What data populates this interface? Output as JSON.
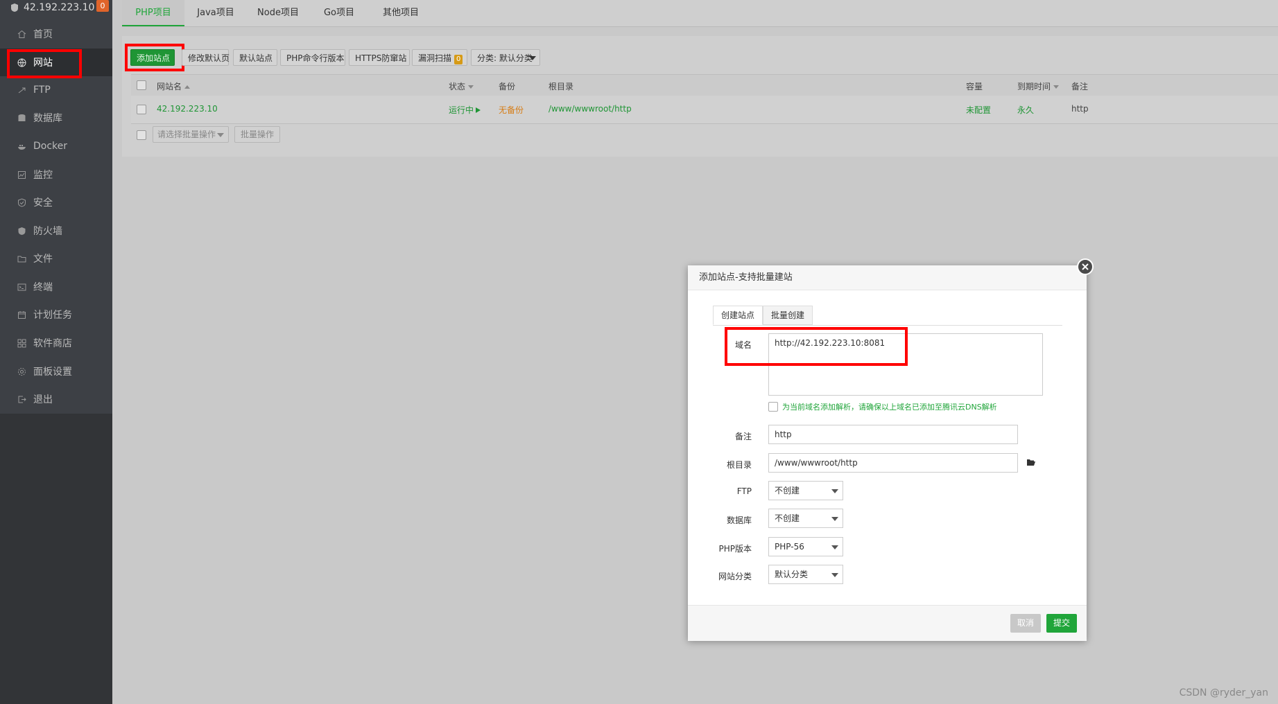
{
  "sidebar": {
    "server_ip": "42.192.223.10",
    "badge": "0",
    "items": [
      {
        "label": "首页",
        "icon": "home-icon"
      },
      {
        "label": "网站",
        "icon": "globe-icon"
      },
      {
        "label": "FTP",
        "icon": "ftp-icon"
      },
      {
        "label": "数据库",
        "icon": "database-icon"
      },
      {
        "label": "Docker",
        "icon": "docker-icon"
      },
      {
        "label": "监控",
        "icon": "monitor-icon"
      },
      {
        "label": "安全",
        "icon": "shield-icon"
      },
      {
        "label": "防火墙",
        "icon": "firewall-icon"
      },
      {
        "label": "文件",
        "icon": "folder-icon"
      },
      {
        "label": "终端",
        "icon": "terminal-icon"
      },
      {
        "label": "计划任务",
        "icon": "calendar-icon"
      },
      {
        "label": "软件商店",
        "icon": "apps-icon"
      },
      {
        "label": "面板设置",
        "icon": "gear-icon"
      },
      {
        "label": "退出",
        "icon": "logout-icon"
      }
    ]
  },
  "tabs": [
    "PHP项目",
    "Java项目",
    "Node项目",
    "Go项目",
    "其他项目"
  ],
  "toolbar": {
    "add_site": "添加站点",
    "edit_default_page": "修改默认页",
    "default_site": "默认站点",
    "php_cli": "PHP命令行版本",
    "https_guard": "HTTPS防窜站",
    "vuln_scan": "漏洞扫描",
    "vuln_count": "0",
    "category": "分类: 默认分类"
  },
  "table": {
    "headers": {
      "name": "网站名",
      "status": "状态",
      "backup": "备份",
      "root": "根目录",
      "capacity": "容量",
      "expire": "到期时间",
      "note": "备注"
    },
    "rows": [
      {
        "name": "42.192.223.10",
        "status": "运行中",
        "backup": "无备份",
        "root": "/www/wwwroot/http",
        "capacity": "未配置",
        "expire": "永久",
        "note": "http"
      }
    ],
    "batch_placeholder": "请选择批量操作",
    "batch_button": "批量操作"
  },
  "modal": {
    "title": "添加站点-支持批量建站",
    "tabs": [
      "创建站点",
      "批量创建"
    ],
    "fields": {
      "domain_label": "域名",
      "domain_value": "http://42.192.223.10:8081",
      "dns_text": "为当前域名添加解析，请确保以上域名已添加至腾讯云DNS解析",
      "note_label": "备注",
      "note_value": "http",
      "root_label": "根目录",
      "root_value": "/www/wwwroot/http",
      "ftp_label": "FTP",
      "ftp_value": "不创建",
      "db_label": "数据库",
      "db_value": "不创建",
      "php_label": "PHP版本",
      "php_value": "PHP-56",
      "cat_label": "网站分类",
      "cat_value": "默认分类"
    },
    "cancel": "取消",
    "submit": "提交"
  },
  "watermark": "CSDN @ryder_yan",
  "colors": {
    "accent": "#20a53a",
    "highlight": "#ff0000",
    "sidebar": "#3d4045"
  }
}
